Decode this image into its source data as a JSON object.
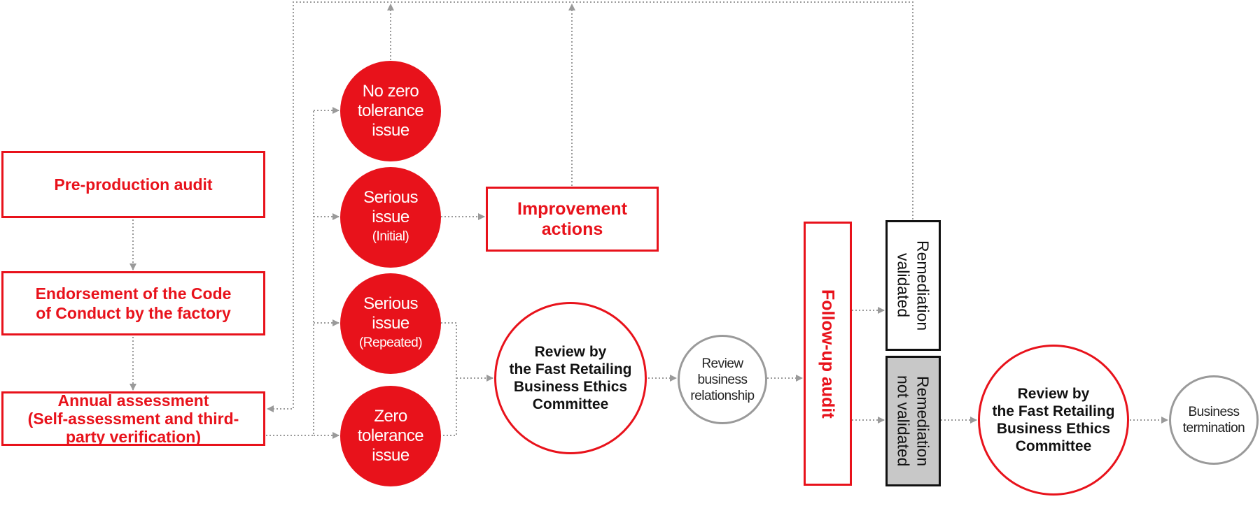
{
  "colors": {
    "accent": "#e8121b",
    "connector": "#9a9a9a",
    "not_validated_fill": "#c8c8c8"
  },
  "nodes": {
    "pre_production": "Pre-production audit",
    "endorsement": "Endorsement of the Code\nof Conduct by the factory",
    "annual": "Annual assessment\n(Self-assessment and third-\nparty verification)",
    "no_zero": "No zero\ntolerance\nissue",
    "serious_initial": "Serious\nissue",
    "serious_initial_sub": "(Initial)",
    "serious_repeated": "Serious\nissue",
    "serious_repeated_sub": "(Repeated)",
    "zero_tolerance": "Zero\ntolerance\nissue",
    "improvement": "Improvement\nactions",
    "review_committee_1": "Review by\nthe Fast Retailing\nBusiness Ethics\nCommittee",
    "review_business": "Review\nbusiness\nrelationship",
    "follow_up": "Follow-up audit",
    "remediation_validated": "Remediation\nvalidated",
    "remediation_not_validated": "Remediation\nnot validated",
    "review_committee_2": "Review by\nthe Fast Retailing\nBusiness Ethics\nCommittee",
    "business_termination": "Business\ntermination"
  }
}
